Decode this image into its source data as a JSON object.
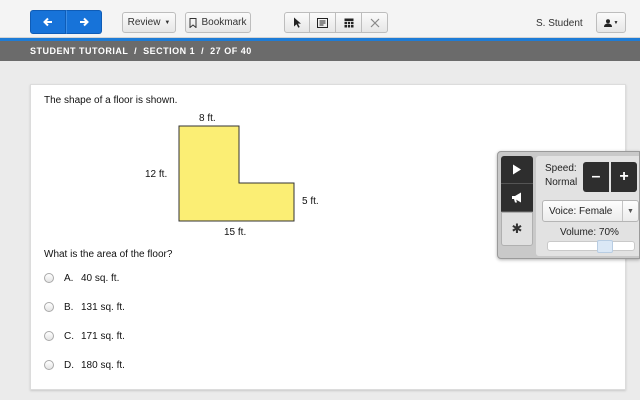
{
  "toolbar": {
    "back_icon": "arrow-left-icon",
    "forward_icon": "arrow-right-icon",
    "review_label": "Review",
    "bookmark_label": "Bookmark",
    "tools": [
      "pointer-icon",
      "note-icon",
      "calculator-icon",
      "eliminator-icon"
    ],
    "student_name": "S. Student",
    "accent_color": "#1773d9"
  },
  "section_bar": {
    "text": "STUDENT TUTORIAL  /  SECTION 1  /  27 OF 40"
  },
  "question": {
    "stem": "The shape of a floor is shown.",
    "figure": {
      "labels": {
        "top": "8 ft.",
        "left": "12 ft.",
        "right": "5 ft.",
        "bottom": "15 ft."
      },
      "fill_color": "#fbee74"
    },
    "prompt": "What is the area of the floor?",
    "options": [
      {
        "letter": "A.",
        "text": "40 sq. ft."
      },
      {
        "letter": "B.",
        "text": "131 sq. ft."
      },
      {
        "letter": "C.",
        "text": "171 sq. ft."
      },
      {
        "letter": "D.",
        "text": "180 sq. ft."
      }
    ]
  },
  "speech_panel": {
    "speed_label": "Speed:",
    "speed_value": "Normal",
    "minus_label": "–",
    "plus_label": "+",
    "voice_label": "Voice: Female",
    "volume_label": "Volume: 70%",
    "volume_level": 0.7
  }
}
